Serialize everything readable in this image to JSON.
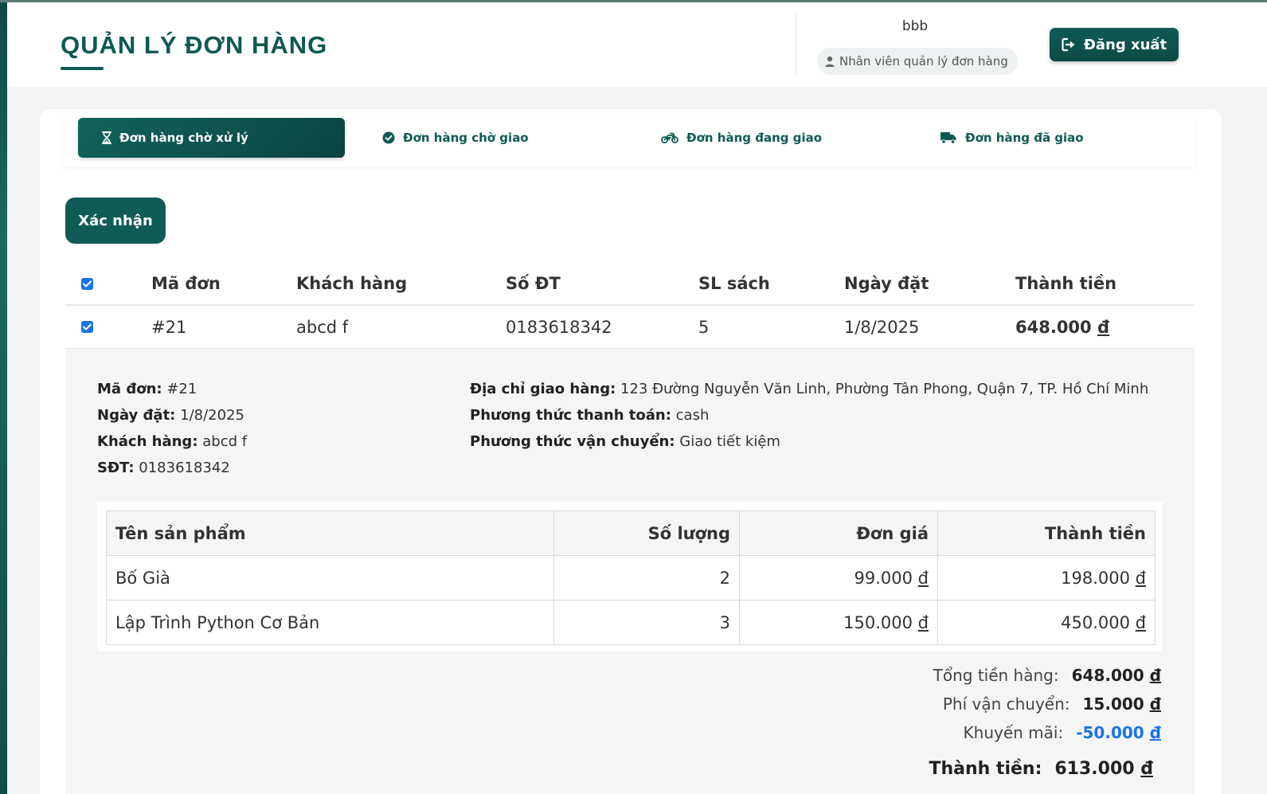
{
  "header": {
    "title": "QUẢN LÝ ĐƠN HÀNG",
    "user_name": "bbb",
    "user_role": "Nhân viên quản lý đơn hàng",
    "logout_label": "Đăng xuất"
  },
  "tabs": [
    {
      "label": "Đơn hàng chờ xử lý",
      "icon": "hourglass-icon",
      "active": true
    },
    {
      "label": "Đơn hàng chờ giao",
      "icon": "check-circle-icon",
      "active": false
    },
    {
      "label": "Đơn hàng đang giao",
      "icon": "motorcycle-icon",
      "active": false
    },
    {
      "label": "Đơn hàng đã giao",
      "icon": "truck-icon",
      "active": false
    }
  ],
  "confirm_label": "Xác nhận",
  "orders_table": {
    "headers": [
      "Mã đơn",
      "Khách hàng",
      "Số ĐT",
      "SL sách",
      "Ngày đặt",
      "Thành tiền"
    ],
    "rows": [
      {
        "id": "#21",
        "customer": "abcd f",
        "phone": "0183618342",
        "qty": "5",
        "date": "1/8/2025",
        "total": "648.000",
        "currency": "đ",
        "checked": true
      }
    ],
    "header_checked": true
  },
  "detail": {
    "order_id_label": "Mã đơn:",
    "order_id": "#21",
    "date_label": "Ngày đặt:",
    "date": "1/8/2025",
    "customer_label": "Khách hàng:",
    "customer": "abcd f",
    "phone_label": "SĐT:",
    "phone": "0183618342",
    "address_label": "Địa chỉ giao hàng:",
    "address": "123 Đường Nguyễn Văn Linh, Phường Tân Phong, Quận 7, TP. Hồ Chí Minh",
    "payment_label": "Phương thức thanh toán:",
    "payment": "cash",
    "shipping_label": "Phương thức vận chuyển:",
    "shipping": "Giao tiết kiệm",
    "items_headers": [
      "Tên sản phẩm",
      "Số lượng",
      "Đơn giá",
      "Thành tiền"
    ],
    "items": [
      {
        "name": "Bố Già",
        "qty": "2",
        "price": "99.000",
        "total": "198.000"
      },
      {
        "name": "Lập Trình Python Cơ Bản",
        "qty": "3",
        "price": "150.000",
        "total": "450.000"
      }
    ],
    "subtotal_label": "Tổng tiền hàng:",
    "subtotal": "648.000",
    "shipping_fee_label": "Phí vận chuyển:",
    "shipping_fee": "15.000",
    "discount_label": "Khuyến mãi:",
    "discount": "-50.000",
    "grand_total_label": "Thành tiền:",
    "grand_total": "613.000",
    "currency": "đ"
  },
  "colors": {
    "primary": "#0f5c55",
    "discount": "#1a73e8",
    "checkbox": "#1a73e8"
  }
}
